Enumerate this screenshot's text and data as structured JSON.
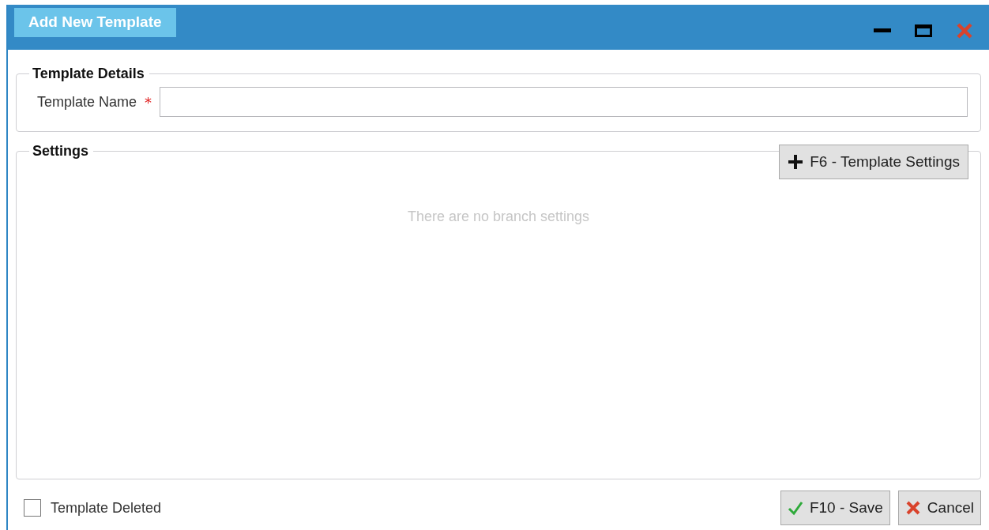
{
  "window": {
    "title": "Add New Template"
  },
  "template_details": {
    "legend": "Template Details",
    "field": {
      "label": "Template Name",
      "required_mark": "*"
    }
  },
  "settings": {
    "legend": "Settings",
    "add_button": "F6 - Template Settings",
    "empty_message": "There are no branch settings"
  },
  "footer": {
    "checkbox": {
      "label": "Template Deleted",
      "checked": false
    },
    "buttons": [
      {
        "kind": "save",
        "label": "F10 - Save"
      },
      {
        "kind": "cancel",
        "label": "Cancel"
      }
    ]
  }
}
